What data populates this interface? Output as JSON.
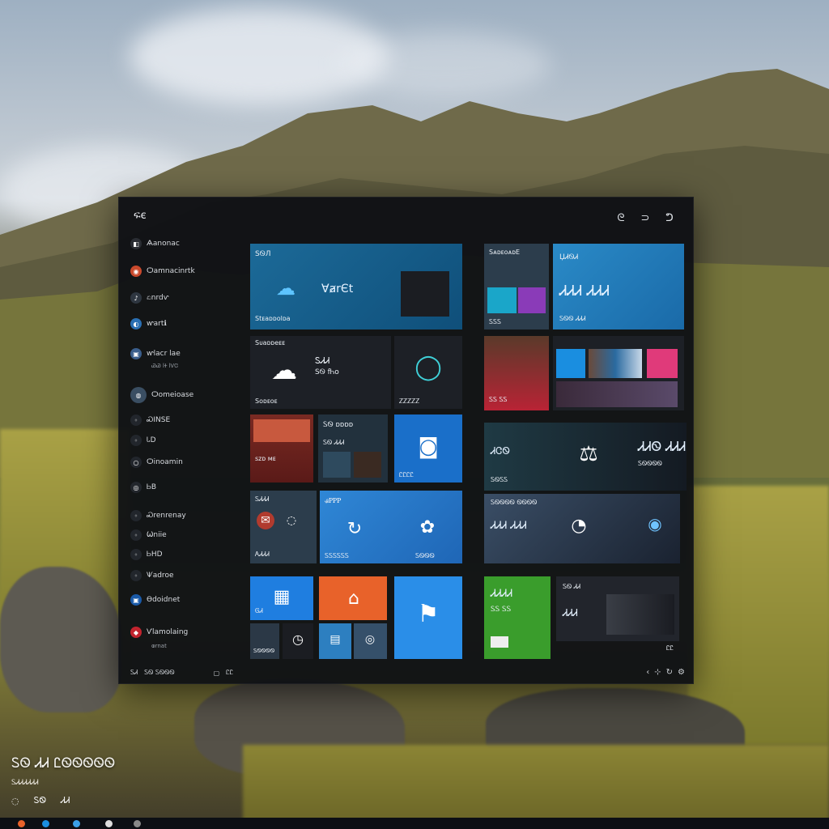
{
  "window": {
    "title": "ፍє",
    "controls": [
      "ᘓ",
      "⊃",
      "ᕤ"
    ]
  },
  "sidebar": {
    "items": [
      {
        "label": "Ѧanonac",
        "icon": "app-icon",
        "color": "#2a2d33"
      },
      {
        "label": "Ѻamnacinrtk",
        "icon": "app-icon",
        "color": "#c9492c"
      },
      {
        "label": "ಏnrdⱱ",
        "icon": "app-icon",
        "color": "#2e3640"
      },
      {
        "label": "ⱳartℹ",
        "icon": "app-icon",
        "color": "#2a6fb3"
      },
      {
        "label": "ⱳlacr lae",
        "icon": "app-icon",
        "color": "#3a5e8c"
      },
      {
        "label": "Ѻomeioase",
        "icon": "app-icon",
        "color": "#3a4e62"
      },
      {
        "label": "ᏍINSE",
        "icon": "app-icon",
        "color": "#22262c"
      },
      {
        "label": "ᏓD",
        "icon": "app-icon",
        "color": "#22262c"
      },
      {
        "label": "Ѻinoamin",
        "icon": "app-icon",
        "color": "#22262c"
      },
      {
        "label": "ᏏB",
        "icon": "app-icon",
        "color": "#22262c"
      },
      {
        "label": "Ꮝrenrenay",
        "icon": "app-icon",
        "color": "#22262c"
      },
      {
        "label": "Ѡniie",
        "icon": "app-icon",
        "color": "#22262c"
      },
      {
        "label": "ᏏHD",
        "icon": "app-icon",
        "color": "#22262c"
      },
      {
        "label": "Ѱadroe",
        "icon": "app-icon",
        "color": "#22262c"
      },
      {
        "label": "Ѳdoidnet",
        "icon": "app-icon",
        "color": "#1a5aa8"
      },
      {
        "label": "Ѵlamolaing",
        "icon": "app-icon",
        "color": "#c2242e"
      }
    ],
    "subs": [
      "ᏊᏊ lᏐ lᏙᏣ",
      "ⱷrnat"
    ]
  },
  "tiles": {
    "t1": {
      "top": "ЅᏫЛ",
      "big": "ⱯⱥrЄt",
      "bottom": "Ѕtᴇaᴅᴅolᴅa"
    },
    "t2": {
      "top": "Ѕᴜаᴅᴅеᴇᴇ",
      "n": "ᏚᏗᏗ",
      "m": "ЅᏫ fᏂᴏ",
      "bottom": "Ѕᴏᴅᴇoᴇ"
    },
    "t3": {
      "bottom": "ᏃᏃᏃᏃᏃ"
    },
    "t4": {
      "label": "ѕᴢᴅ ᴍᴇ"
    },
    "t5": {
      "top": "ᏚᏫ ᴅᴅᴅᴅ",
      "bottom": "ᏚᏫ ᏗᏗᏗ"
    },
    "t6": {
      "bottom": "ᏝᏝᏝᏝ"
    },
    "t7": {
      "top": "ᏚᏗᏗᏗ",
      "bottom": "ᎪᏗᏗᏗ"
    },
    "t8": {
      "top": "ᏸᏢᏢᏢ",
      "bottom": "ᏚᏚᏚᏚᏚᏚ",
      "foot": "ᏚᏫᏫᏫ"
    },
    "t9": {
      "label": "ᎶᏗ"
    },
    "t10": {
      "top": "ᏚᏫᏫᏫᏫ"
    },
    "t11": {
      "label": "ᏚᏗᏗᏫ"
    },
    "t12": {
      "top": "ЅᴀᴅᴇоᴀᴅЕ",
      "bottom": "ᏚᏚᏚ"
    },
    "t13": {
      "top": "ЏᏗᏫᏗ",
      "big": "ᏗᏗᏗ ᏗᏗᏗ",
      "bottom": "ᏚᏫᏫ ᏗᏗᏗ"
    },
    "t14": {
      "label": "ᏚᏚ ᏚᏚ"
    },
    "t15": {
      "big": "ᏗᏣᏫ",
      "small": "ᏚᏫᏚᏚ"
    },
    "t16": {
      "big": "ᏗᏗᏫ ᏗᏗᏗ",
      "sub": "ᏚᏫᏫᏫᏫ"
    },
    "t17": {
      "top": "ᏚᏫᏫᏫᏫ ᏫᏫᏫᏫ",
      "big": "ᏗᏗᏗ ᏗᏗᏗ"
    },
    "t18": {
      "big": "ᏗᏗᏗ",
      "small": "ᏚᏫ ᏗᏗ",
      "foot": "ᏝᏝ"
    },
    "t19": {
      "big": "ᏗᏗᏗᏗ",
      "small": "ᏚᏚ ᏚᏚ"
    },
    "t20": {
      "top": "ᏚᏫᏫᏫᏫ",
      "big": "Ᏻ"
    }
  },
  "bottom_bar": {
    "left": [
      "ᏚᏗ",
      "ᏚᏫ ᏚᏫᏫᏫ",
      "ᏝᏝ"
    ],
    "right": [
      "ᏚᏫᏫᏫ"
    ]
  },
  "desktop": {
    "title": "ᏚᏫ ᏗᏗ ᏝᏫᏫᏫᏫᏫ",
    "subtitle": "ᏚᏗᏗᏗᏗᏗᏗ",
    "row": [
      "ᏚᏫ",
      "ᏗᏗ"
    ]
  },
  "colors": {
    "window_bg": "#0e1014",
    "tile_blue": "#1f77d4",
    "tile_orange": "#e8622a",
    "tile_green": "#3a9d2c",
    "tile_teal": "#1d6a95"
  }
}
